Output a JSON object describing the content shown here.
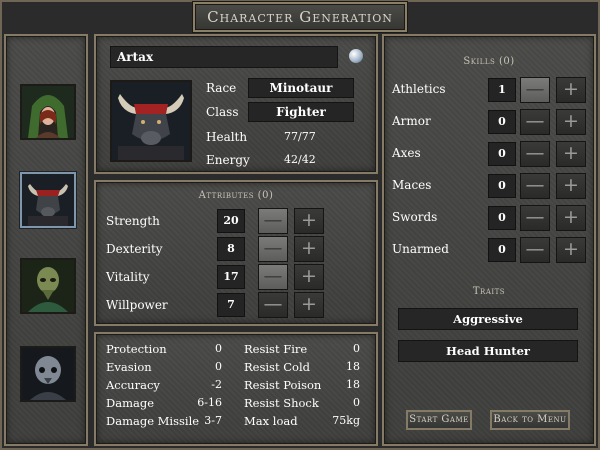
{
  "title": "Character Generation",
  "character": {
    "name": "Artax",
    "race_label": "Race",
    "race": "Minotaur",
    "class_label": "Class",
    "class": "Fighter",
    "health_label": "Health",
    "health": "77/77",
    "energy_label": "Energy",
    "energy": "42/42"
  },
  "attributes": {
    "title": "Attributes (0)",
    "items": [
      {
        "label": "Strength",
        "value": "20"
      },
      {
        "label": "Dexterity",
        "value": "8"
      },
      {
        "label": "Vitality",
        "value": "17"
      },
      {
        "label": "Willpower",
        "value": "7"
      }
    ]
  },
  "stats": {
    "left": [
      {
        "label": "Protection",
        "value": "0"
      },
      {
        "label": "Evasion",
        "value": "0"
      },
      {
        "label": "Accuracy",
        "value": "-2"
      },
      {
        "label": "Damage",
        "value": "6-16"
      },
      {
        "label": "Damage Missile",
        "value": "3-7"
      }
    ],
    "right": [
      {
        "label": "Resist Fire",
        "value": "0"
      },
      {
        "label": "Resist Cold",
        "value": "18"
      },
      {
        "label": "Resist Poison",
        "value": "18"
      },
      {
        "label": "Resist Shock",
        "value": "0"
      },
      {
        "label": "Max load",
        "value": "75kg"
      }
    ]
  },
  "skills": {
    "title": "Skills (0)",
    "items": [
      {
        "label": "Athletics",
        "value": "1"
      },
      {
        "label": "Armor",
        "value": "0"
      },
      {
        "label": "Axes",
        "value": "0"
      },
      {
        "label": "Maces",
        "value": "0"
      },
      {
        "label": "Swords",
        "value": "0"
      },
      {
        "label": "Unarmed",
        "value": "0"
      }
    ]
  },
  "traits": {
    "title": "Traits",
    "items": [
      "Aggressive",
      "Head Hunter"
    ]
  },
  "buttons": {
    "start": "Start Game",
    "back": "Back to Menu",
    "minus_glyph": "—",
    "plus_glyph": "+"
  },
  "colors": {
    "panel": "#444442",
    "border": "#857a65",
    "selected_portrait": "#7f97ad"
  }
}
